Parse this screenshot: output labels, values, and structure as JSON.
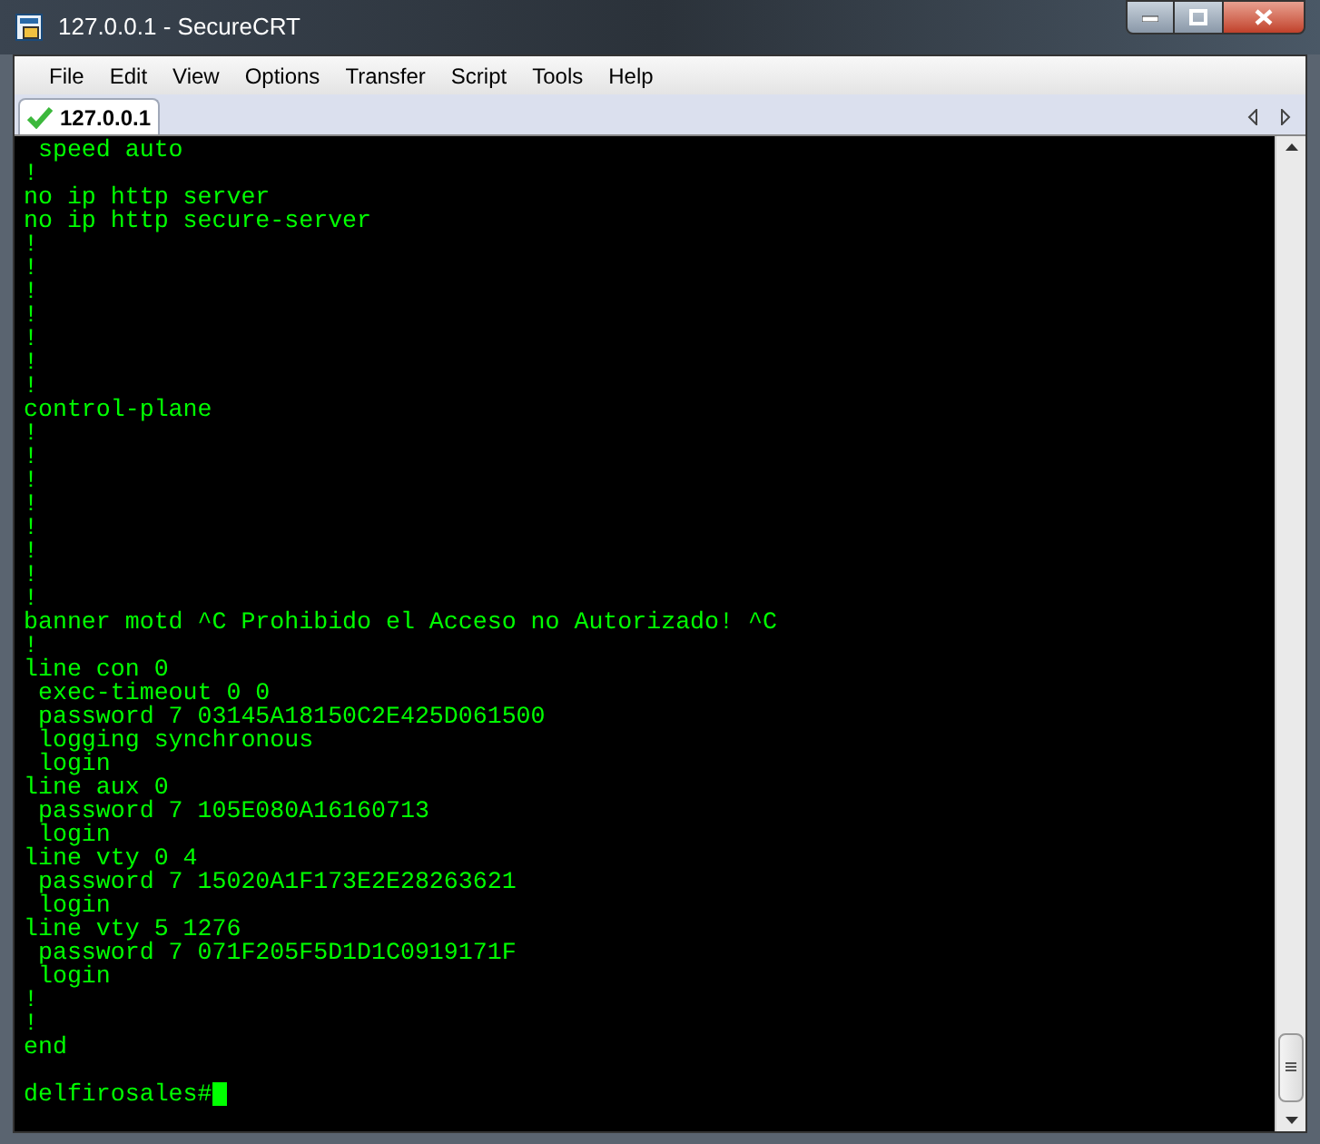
{
  "window": {
    "title": "127.0.0.1 - SecureCRT"
  },
  "menu": [
    "File",
    "Edit",
    "View",
    "Options",
    "Transfer",
    "Script",
    "Tools",
    "Help"
  ],
  "tabs": [
    {
      "label": "127.0.0.1",
      "selected": true,
      "connected": true
    }
  ],
  "terminal": {
    "lines": [
      " speed auto",
      "!",
      "no ip http server",
      "no ip http secure-server",
      "!",
      "!",
      "!",
      "!",
      "!",
      "!",
      "!",
      "control-plane",
      "!",
      "!",
      "!",
      "!",
      "!",
      "!",
      "!",
      "!",
      "banner motd ^C Prohibido el Acceso no Autorizado! ^C",
      "!",
      "line con 0",
      " exec-timeout 0 0",
      " password 7 03145A18150C2E425D061500",
      " logging synchronous",
      " login",
      "line aux 0",
      " password 7 105E080A16160713",
      " login",
      "line vty 0 4",
      " password 7 15020A1F173E2E28263621",
      " login",
      "line vty 5 1276",
      " password 7 071F205F5D1D1C0919171F",
      " login",
      "!",
      "!",
      "end"
    ],
    "prompt": "delfirosales#"
  }
}
